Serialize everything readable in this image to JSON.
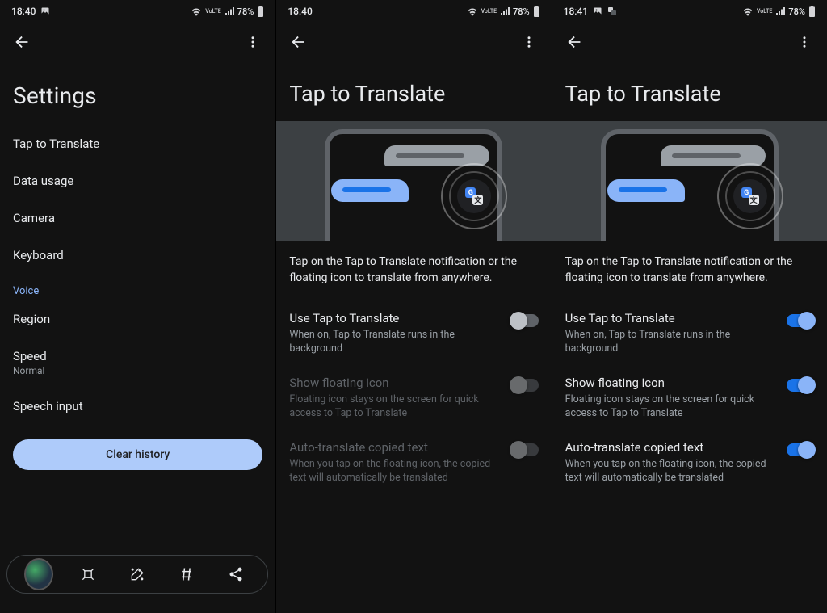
{
  "screens": [
    {
      "status": {
        "time": "18:40",
        "indicators": "⋯",
        "battery": "78%"
      },
      "title": "Settings",
      "items": [
        {
          "label": "Tap to Translate"
        },
        {
          "label": "Data usage"
        },
        {
          "label": "Camera"
        },
        {
          "label": "Keyboard"
        }
      ],
      "voice_header": "Voice",
      "voice_items": [
        {
          "label": "Region"
        },
        {
          "label": "Speed",
          "sub": "Normal"
        },
        {
          "label": "Speech input"
        }
      ],
      "clear_button": "Clear history"
    },
    {
      "status": {
        "time": "18:40",
        "battery": "78%"
      },
      "title": "Tap to Translate",
      "description": "Tap on the Tap to Translate notification or the floating icon to translate from anywhere.",
      "settings": [
        {
          "title": "Use Tap to Translate",
          "sub": "When on, Tap to Translate runs in the background",
          "on": false,
          "enabled": true
        },
        {
          "title": "Show floating icon",
          "sub": "Floating icon stays on the screen for quick access to Tap to Translate",
          "on": false,
          "enabled": false
        },
        {
          "title": "Auto-translate copied text",
          "sub": "When you tap on the floating icon, the copied text will automatically be translated",
          "on": false,
          "enabled": false
        }
      ]
    },
    {
      "status": {
        "time": "18:41",
        "battery": "78%"
      },
      "title": "Tap to Translate",
      "description": "Tap on the Tap to Translate notification or the floating icon to translate from anywhere.",
      "settings": [
        {
          "title": "Use Tap to Translate",
          "sub": "When on, Tap to Translate runs in the background",
          "on": true,
          "enabled": true
        },
        {
          "title": "Show floating icon",
          "sub": "Floating icon stays on the screen for quick access to Tap to Translate",
          "on": true,
          "enabled": true
        },
        {
          "title": "Auto-translate copied text",
          "sub": "When you tap on the floating icon, the copied text will automatically be translated",
          "on": true,
          "enabled": true
        }
      ]
    }
  ]
}
